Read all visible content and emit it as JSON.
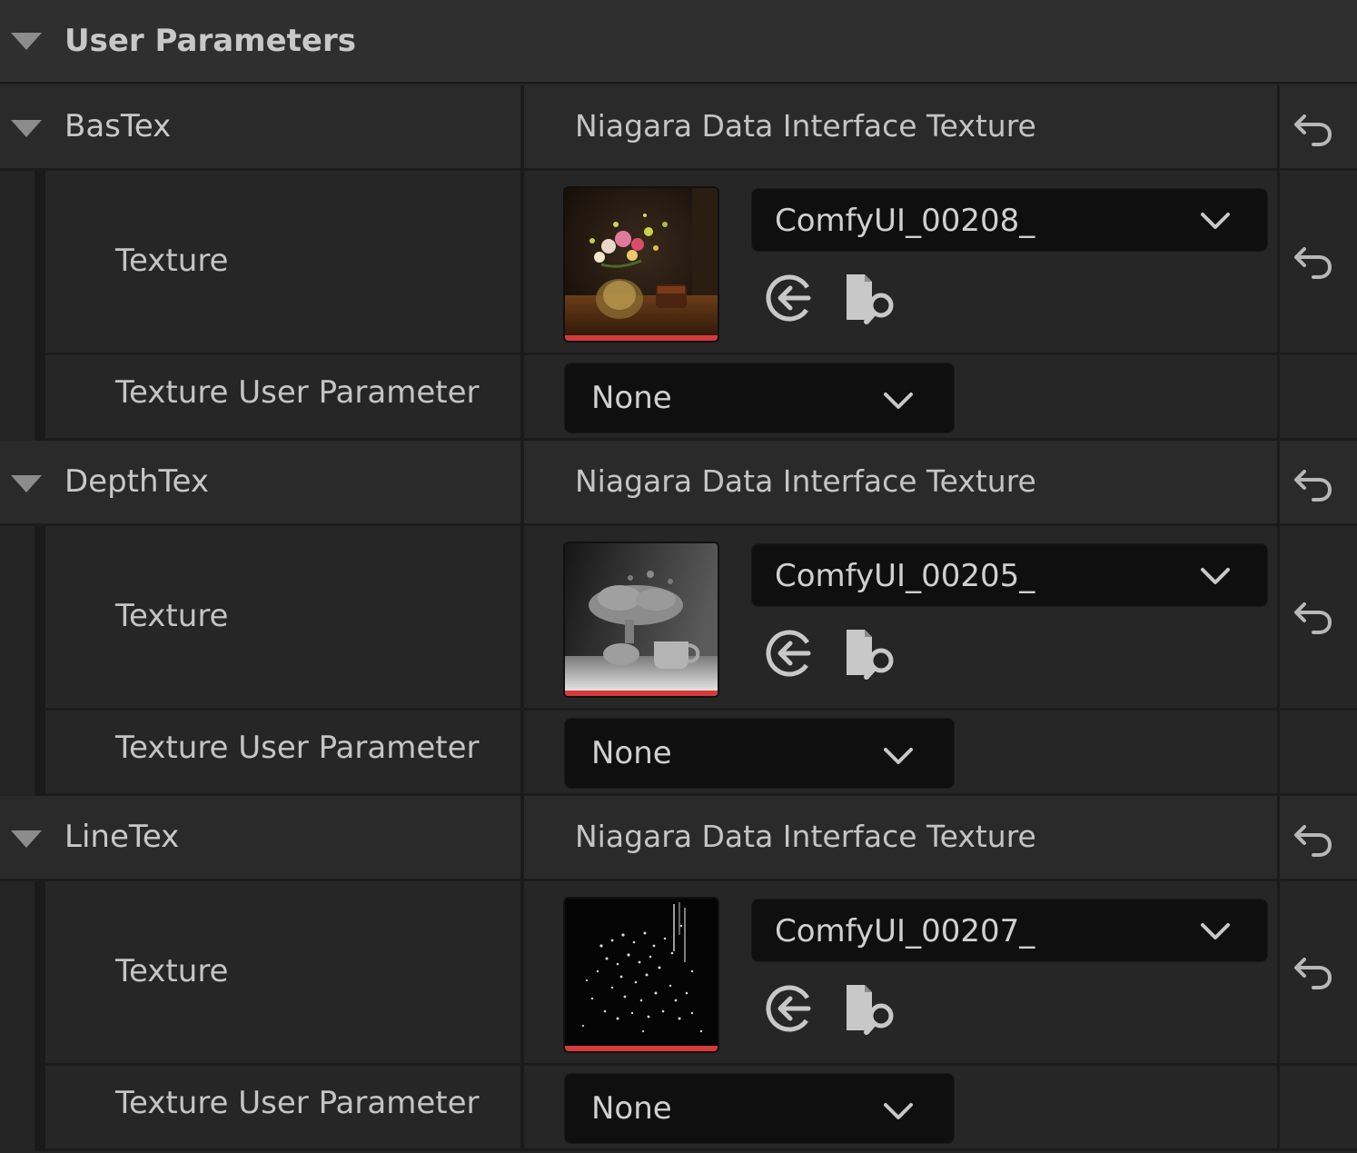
{
  "panel": {
    "title": "User Parameters"
  },
  "groups": [
    {
      "name": "BasTex",
      "type_label": "Niagara Data Interface Texture",
      "texture_label": "Texture",
      "texture_asset": "ComfyUI_00208_",
      "thumbnail": "flower-vase-photo",
      "param_label": "Texture User Parameter",
      "param_value": "None"
    },
    {
      "name": "DepthTex",
      "type_label": "Niagara Data Interface Texture",
      "texture_label": "Texture",
      "texture_asset": "ComfyUI_00205_",
      "thumbnail": "depth-map",
      "param_label": "Texture User Parameter",
      "param_value": "None"
    },
    {
      "name": "LineTex",
      "type_label": "Niagara Data Interface Texture",
      "texture_label": "Texture",
      "texture_asset": "ComfyUI_00207_",
      "thumbnail": "line-art",
      "param_label": "Texture User Parameter",
      "param_value": "None"
    }
  ],
  "colors": {
    "background": "#242424",
    "header": "#2f2f2f",
    "combo": "#0f0f0f",
    "thumb_accent": "#d63a3a",
    "text": "#c4c4c4"
  }
}
